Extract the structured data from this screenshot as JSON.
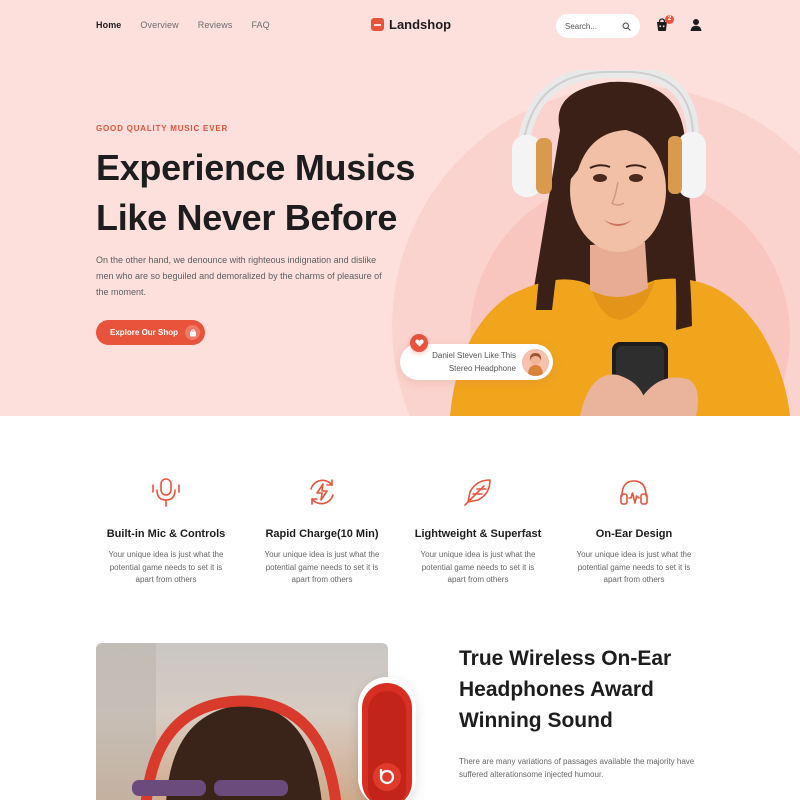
{
  "nav": {
    "links": [
      "Home",
      "Overview",
      "Reviews",
      "FAQ"
    ],
    "logo": "Landshop",
    "search_placeholder": "Search...",
    "cart_count": "2"
  },
  "hero": {
    "eyebrow": "GOOD QUALITY MUSIC EVER",
    "title_line1": "Experience Musics",
    "title_line2": "Like Never Before",
    "description": "On the other hand, we denounce with righteous indignation and dislike men who are so beguiled and demoralized by the charms of pleasure of the moment.",
    "cta_label": "Explore Our Shop",
    "like_line1": "Daniel Steven Like This",
    "like_line2": "Stereo Headphone"
  },
  "features": [
    {
      "icon": "microphone-icon",
      "title": "Built-in Mic & Controls",
      "desc": "Your unique idea is just what the potential game needs to set it is apart from others"
    },
    {
      "icon": "charge-icon",
      "title": "Rapid Charge(10 Min)",
      "desc": "Your unique idea is just what the potential game needs to set it is apart from others"
    },
    {
      "icon": "feather-icon",
      "title": "Lightweight & Superfast",
      "desc": "Your unique idea is just what the potential game needs to set it is apart from others"
    },
    {
      "icon": "headphone-icon",
      "title": "On-Ear Design",
      "desc": "Your unique idea is just what the potential game needs to set it is apart from others"
    }
  ],
  "product": {
    "title_line1": "True Wireless On-Ear",
    "title_line2": "Headphones Award",
    "title_line3": "Winning Sound",
    "description": "There are many variations of passages available the majority have suffered alterationsome injected humour."
  },
  "colors": {
    "accent": "#e8533b",
    "hero_bg": "#fde0dc",
    "text_dark": "#1d1d1d"
  }
}
